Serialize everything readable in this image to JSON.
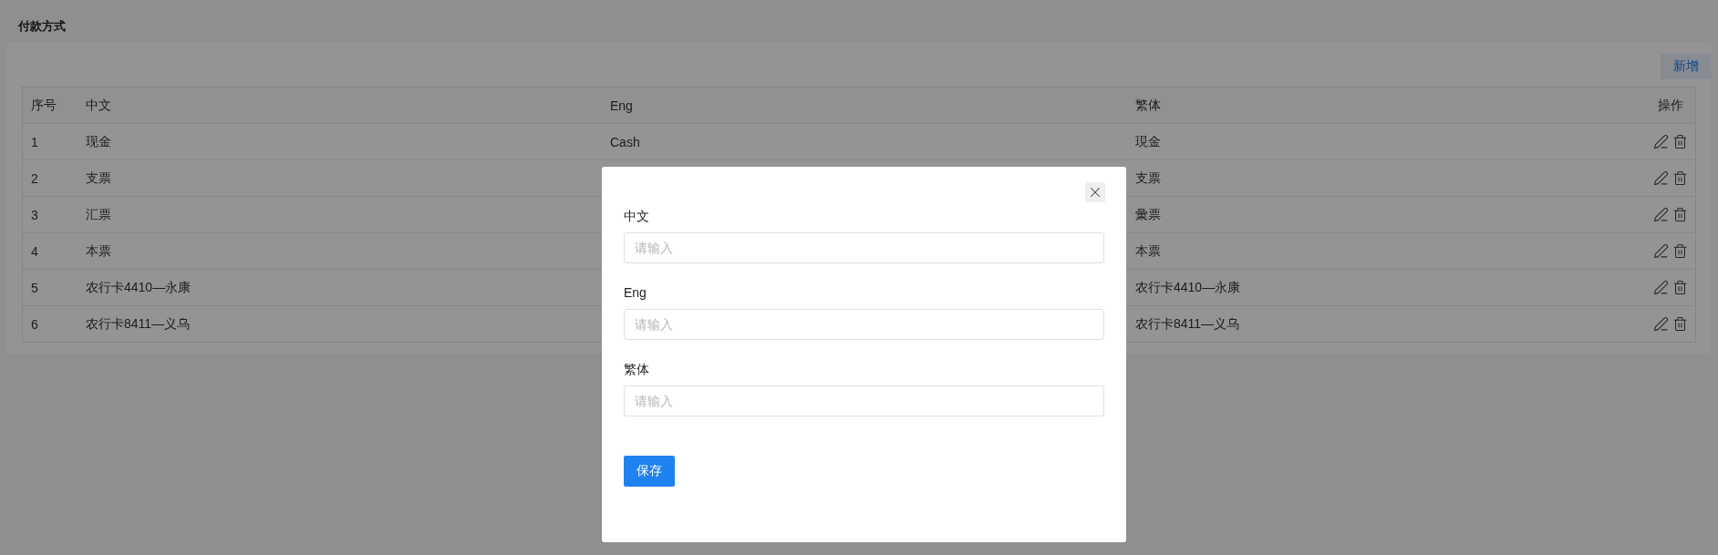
{
  "page": {
    "title": "付款方式"
  },
  "toolbar": {
    "add_button": "新增"
  },
  "table": {
    "columns": [
      "序号",
      "中文",
      "Eng",
      "繁体",
      "操作"
    ],
    "rows": [
      {
        "index": "1",
        "zh": "现金",
        "eng": "Cash",
        "zh_hant": "現金"
      },
      {
        "index": "2",
        "zh": "支票",
        "zh_hant": "支票"
      },
      {
        "index": "3",
        "zh": "汇票",
        "zh_hant": "彙票"
      },
      {
        "index": "4",
        "zh": "本票",
        "zh_hant": "本票"
      },
      {
        "index": "5",
        "zh": "农行卡4410—永康",
        "zh_hant": "农行卡4410—永康"
      },
      {
        "index": "6",
        "zh": "农行卡8411—义乌",
        "zh_hant": "农行卡8411—义乌"
      }
    ]
  },
  "dialog": {
    "fields": [
      {
        "label": "中文",
        "placeholder": "请输入"
      },
      {
        "label": "Eng",
        "placeholder": "请输入"
      },
      {
        "label": "繁体",
        "placeholder": "请输入"
      }
    ],
    "save_button": "保存"
  }
}
